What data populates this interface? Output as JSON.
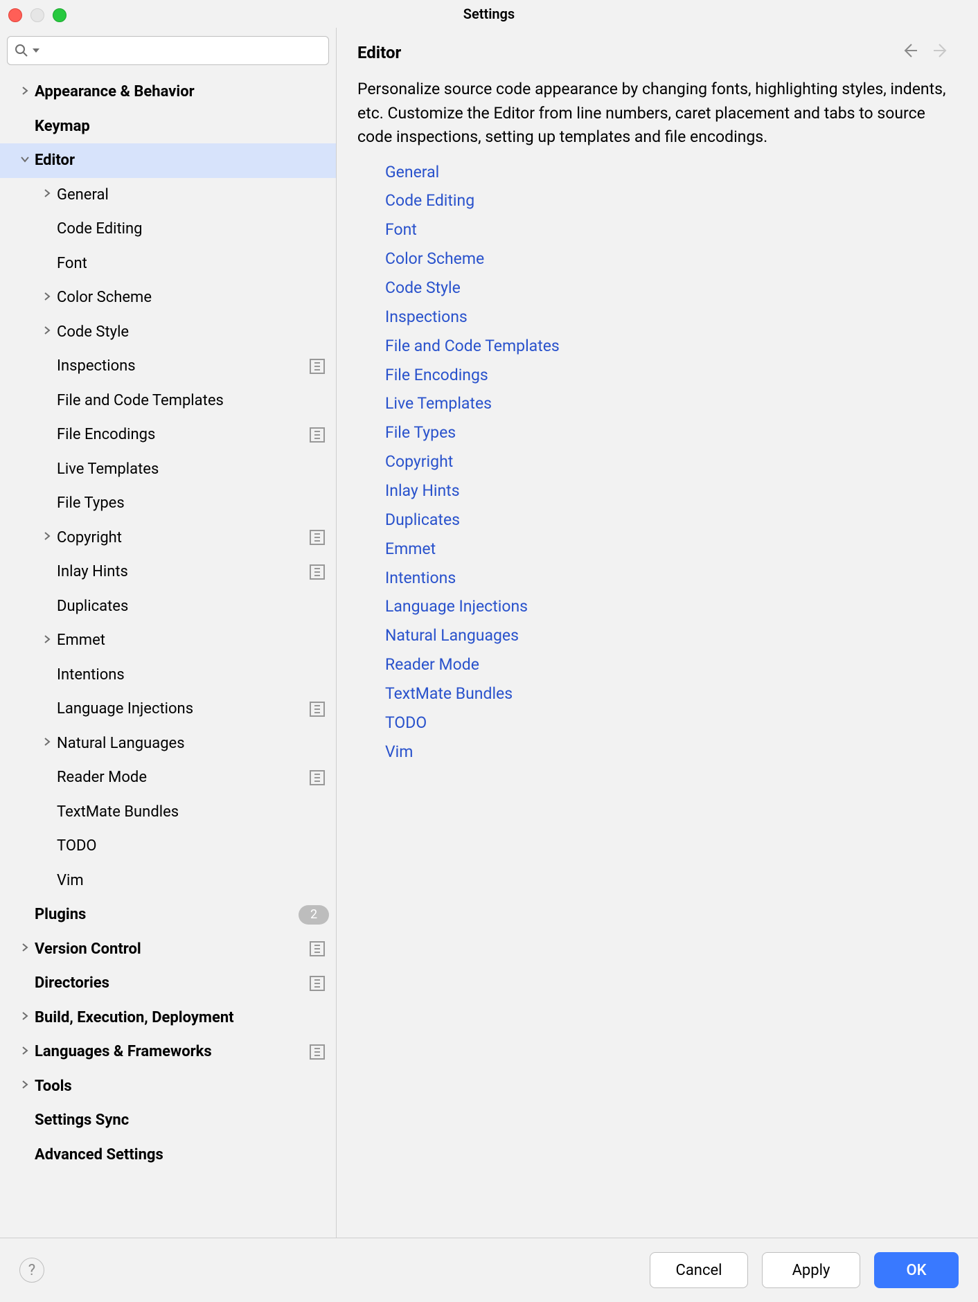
{
  "window": {
    "title": "Settings"
  },
  "search": {
    "placeholder": ""
  },
  "sidebar": [
    {
      "label": "Appearance & Behavior",
      "bold": true,
      "expandable": true,
      "expanded": false,
      "indent": 0
    },
    {
      "label": "Keymap",
      "bold": true,
      "expandable": false,
      "indent": 0
    },
    {
      "label": "Editor",
      "bold": true,
      "expandable": true,
      "expanded": true,
      "selected": true,
      "indent": 0
    },
    {
      "label": "General",
      "bold": false,
      "expandable": true,
      "expanded": false,
      "indent": 1
    },
    {
      "label": "Code Editing",
      "bold": false,
      "expandable": false,
      "indent": 1
    },
    {
      "label": "Font",
      "bold": false,
      "expandable": false,
      "indent": 1
    },
    {
      "label": "Color Scheme",
      "bold": false,
      "expandable": true,
      "expanded": false,
      "indent": 1
    },
    {
      "label": "Code Style",
      "bold": false,
      "expandable": true,
      "expanded": false,
      "indent": 1
    },
    {
      "label": "Inspections",
      "bold": false,
      "expandable": false,
      "indent": 1,
      "proj_icon": true
    },
    {
      "label": "File and Code Templates",
      "bold": false,
      "expandable": false,
      "indent": 1
    },
    {
      "label": "File Encodings",
      "bold": false,
      "expandable": false,
      "indent": 1,
      "proj_icon": true
    },
    {
      "label": "Live Templates",
      "bold": false,
      "expandable": false,
      "indent": 1
    },
    {
      "label": "File Types",
      "bold": false,
      "expandable": false,
      "indent": 1
    },
    {
      "label": "Copyright",
      "bold": false,
      "expandable": true,
      "expanded": false,
      "indent": 1,
      "proj_icon": true
    },
    {
      "label": "Inlay Hints",
      "bold": false,
      "expandable": false,
      "indent": 1,
      "proj_icon": true
    },
    {
      "label": "Duplicates",
      "bold": false,
      "expandable": false,
      "indent": 1
    },
    {
      "label": "Emmet",
      "bold": false,
      "expandable": true,
      "expanded": false,
      "indent": 1
    },
    {
      "label": "Intentions",
      "bold": false,
      "expandable": false,
      "indent": 1
    },
    {
      "label": "Language Injections",
      "bold": false,
      "expandable": false,
      "indent": 1,
      "proj_icon": true
    },
    {
      "label": "Natural Languages",
      "bold": false,
      "expandable": true,
      "expanded": false,
      "indent": 1
    },
    {
      "label": "Reader Mode",
      "bold": false,
      "expandable": false,
      "indent": 1,
      "proj_icon": true
    },
    {
      "label": "TextMate Bundles",
      "bold": false,
      "expandable": false,
      "indent": 1
    },
    {
      "label": "TODO",
      "bold": false,
      "expandable": false,
      "indent": 1
    },
    {
      "label": "Vim",
      "bold": false,
      "expandable": false,
      "indent": 1
    },
    {
      "label": "Plugins",
      "bold": true,
      "expandable": false,
      "indent": 0,
      "badge": "2"
    },
    {
      "label": "Version Control",
      "bold": true,
      "expandable": true,
      "expanded": false,
      "indent": 0,
      "proj_icon": true
    },
    {
      "label": "Directories",
      "bold": true,
      "expandable": false,
      "indent": 0,
      "proj_icon": true
    },
    {
      "label": "Build, Execution, Deployment",
      "bold": true,
      "expandable": true,
      "expanded": false,
      "indent": 0
    },
    {
      "label": "Languages & Frameworks",
      "bold": true,
      "expandable": true,
      "expanded": false,
      "indent": 0,
      "proj_icon": true
    },
    {
      "label": "Tools",
      "bold": true,
      "expandable": true,
      "expanded": false,
      "indent": 0
    },
    {
      "label": "Settings Sync",
      "bold": true,
      "expandable": false,
      "indent": 0
    },
    {
      "label": "Advanced Settings",
      "bold": true,
      "expandable": false,
      "indent": 0
    }
  ],
  "panel": {
    "title": "Editor",
    "description": "Personalize source code appearance by changing fonts, highlighting styles, indents, etc. Customize the Editor from line numbers, caret placement and tabs to source code inspections, setting up templates and file encodings.",
    "links": [
      "General",
      "Code Editing",
      "Font",
      "Color Scheme",
      "Code Style",
      "Inspections",
      "File and Code Templates",
      "File Encodings",
      "Live Templates",
      "File Types",
      "Copyright",
      "Inlay Hints",
      "Duplicates",
      "Emmet",
      "Intentions",
      "Language Injections",
      "Natural Languages",
      "Reader Mode",
      "TextMate Bundles",
      "TODO",
      "Vim"
    ]
  },
  "footer": {
    "cancel": "Cancel",
    "apply": "Apply",
    "ok": "OK"
  }
}
